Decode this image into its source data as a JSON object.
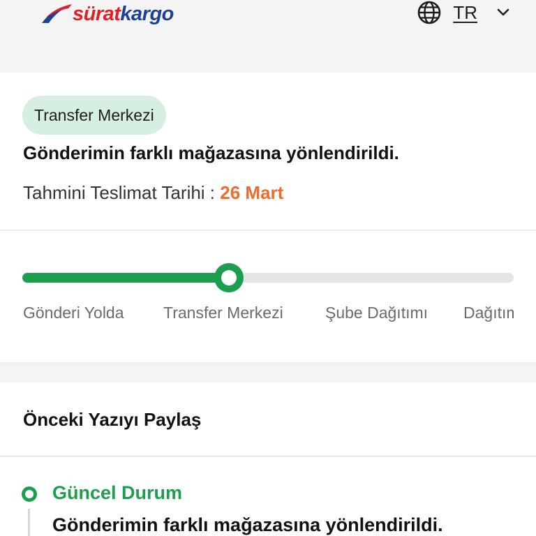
{
  "header": {
    "logo": {
      "part1": "sürat",
      "part2": "kargo",
      "colors": {
        "red": "#e21f26",
        "blue": "#1f3f93"
      }
    },
    "language": {
      "code": "TR",
      "icon": "globe-icon",
      "dropdown_icon": "chevron-down-icon"
    }
  },
  "status": {
    "badge": "Transfer Merkezi",
    "message": "Gönderimin farklı mağazasına yönlendirildi.",
    "eta_label": "Tahmini Teslimat Tarihi :",
    "eta_date": "26 Mart",
    "colors": {
      "badge_bg": "#d7efe1",
      "eta_date": "#ef6c2f"
    }
  },
  "progress": {
    "fraction": 0.42,
    "steps": [
      "Gönderi Yolda",
      "Transfer Merkezi",
      "Şube Dağıtımı",
      "Dağıtım"
    ],
    "current_step": 1,
    "color": "#1d9e4f"
  },
  "share": {
    "title": "Önceki Yazıyı Paylaş"
  },
  "history": {
    "title": "Güncel Durum",
    "message": "Gönderimin farklı mağazasına yönlendirildi.",
    "color": "#1d9e4f"
  }
}
